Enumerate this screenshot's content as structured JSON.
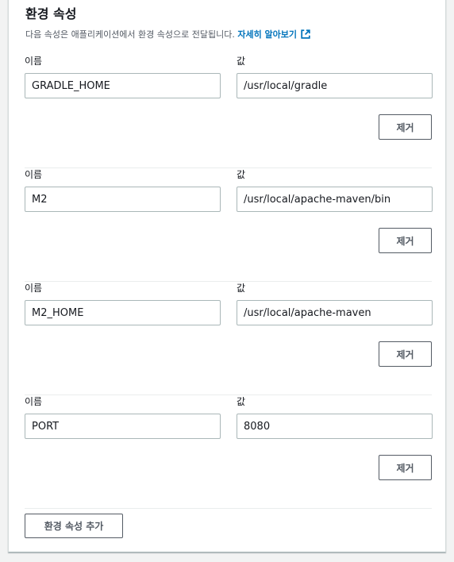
{
  "section": {
    "title": "환경 속성",
    "description": "다음 속성은 애플리케이션에서 환경 속성으로 전달됩니다.",
    "learn_more_link": "자세히 알아보기",
    "link_icon": "external-link-icon",
    "accent_color": "#0073bb"
  },
  "labels": {
    "name": "이름",
    "value": "값"
  },
  "properties": [
    {
      "name": "GRADLE_HOME",
      "value": "/usr/local/gradle",
      "remove_label": "제거"
    },
    {
      "name": "M2",
      "value": "/usr/local/apache-maven/bin",
      "remove_label": "제거"
    },
    {
      "name": "M2_HOME",
      "value": "/usr/local/apache-maven",
      "remove_label": "제거"
    },
    {
      "name": "PORT",
      "value": "8080",
      "remove_label": "제거"
    }
  ],
  "add_button_label": "환경 속성 추가"
}
